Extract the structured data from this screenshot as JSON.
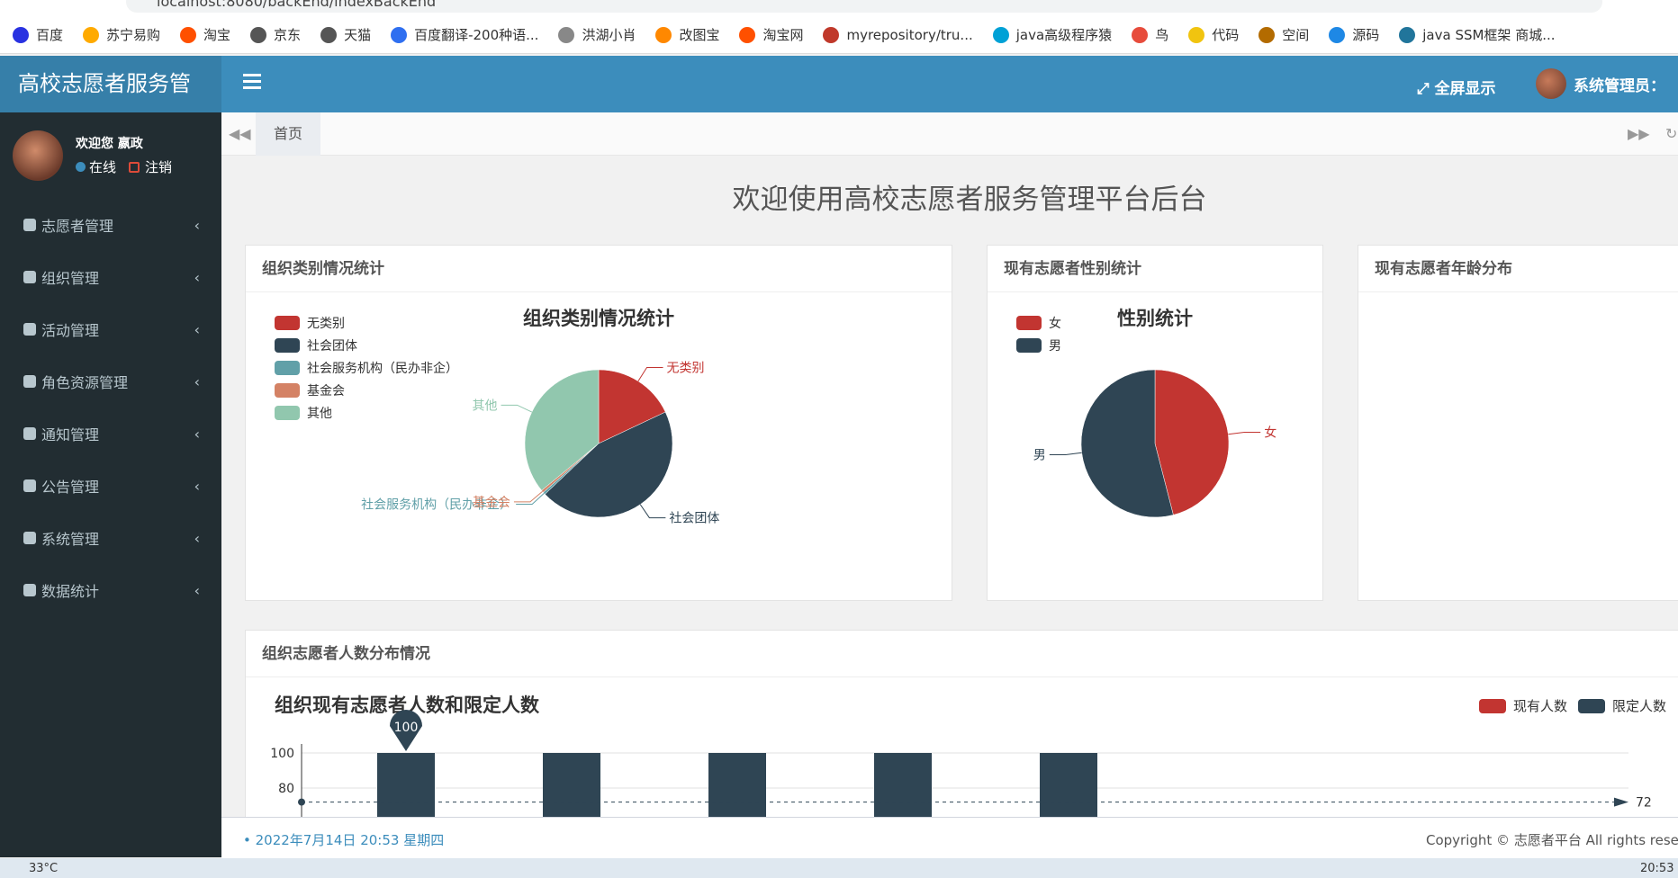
{
  "browser": {
    "url": "localhost:8080/backEnd/indexBackEnd",
    "bookmarks": [
      {
        "label": "百度",
        "color": "#2932e1"
      },
      {
        "label": "苏宁易购",
        "color": "#ffaa00"
      },
      {
        "label": "淘宝",
        "color": "#ff5000"
      },
      {
        "label": "京东",
        "color": "#555555"
      },
      {
        "label": "天猫",
        "color": "#555555"
      },
      {
        "label": "百度翻译-200种语...",
        "color": "#2f6ff0"
      },
      {
        "label": "洪湖小肖",
        "color": "#888888"
      },
      {
        "label": "改图宝",
        "color": "#ff8800"
      },
      {
        "label": "淘宝网",
        "color": "#ff5000"
      },
      {
        "label": "myrepository/tru...",
        "color": "#c0392b"
      },
      {
        "label": "java高级程序猿",
        "color": "#00a1d6"
      },
      {
        "label": "鸟",
        "color": "#e74c3c"
      },
      {
        "label": "代码",
        "color": "#f1c40f"
      },
      {
        "label": "空间",
        "color": "#b36b00"
      },
      {
        "label": "源码",
        "color": "#1e88e5"
      },
      {
        "label": "java SSM框架 商城...",
        "color": "#21759b"
      }
    ]
  },
  "header": {
    "logo": "高校志愿者服务管",
    "fullscreen_label": "全屏显示",
    "admin_label": "系统管理员：",
    "accent": "#3c8dbc"
  },
  "sidebar": {
    "welcome": "欢迎您 嬴政",
    "online": "在线",
    "logout": "注销",
    "items": [
      {
        "label": "志愿者管理"
      },
      {
        "label": "组织管理"
      },
      {
        "label": "活动管理"
      },
      {
        "label": "角色资源管理"
      },
      {
        "label": "通知管理"
      },
      {
        "label": "公告管理"
      },
      {
        "label": "系统管理"
      },
      {
        "label": "数据统计"
      }
    ]
  },
  "tabs": {
    "home": "首页"
  },
  "main": {
    "title": "欢迎使用高校志愿者服务管理平台后台",
    "box1_title": "组织类别情况统计",
    "box2_title": "现有志愿者性别统计",
    "box3_title": "现有志愿者年龄分布",
    "box4_title": "组织志愿者人数分布情况"
  },
  "chart_data": [
    {
      "type": "pie",
      "title": "组织类别情况统计",
      "series": [
        {
          "name": "无类别",
          "value": 1,
          "color": "#c23531"
        },
        {
          "name": "社会团体",
          "value": 2.5,
          "color": "#2f4554"
        },
        {
          "name": "社会服务机构（民办非企）",
          "value": 0.03,
          "color": "#61a0a8"
        },
        {
          "name": "基金会",
          "value": 0.03,
          "color": "#d48265"
        },
        {
          "name": "其他",
          "value": 2,
          "color": "#91c7ae"
        }
      ]
    },
    {
      "type": "pie",
      "title": "性别统计",
      "series": [
        {
          "name": "女",
          "value": 46,
          "color": "#c23531"
        },
        {
          "name": "男",
          "value": 54,
          "color": "#2f4554"
        }
      ]
    },
    {
      "type": "bar",
      "title": "组织现有志愿者人数和限定人数",
      "legend": [
        "现有人数",
        "限定人数"
      ],
      "colors": [
        "#c23531",
        "#2f4554"
      ],
      "y_ticks": [
        100,
        80
      ],
      "series": [
        {
          "name": "现有人数",
          "values": [
            0,
            0,
            0,
            0,
            0
          ]
        },
        {
          "name": "限定人数",
          "values": [
            100,
            100,
            100,
            100,
            100
          ]
        }
      ],
      "max_marker": "100",
      "mark_line": "72"
    }
  ],
  "footer": {
    "date": "2022年7月14日 20:53 星期四",
    "copyright": "Copyright © 志愿者平台 All rights rese"
  },
  "taskbar": {
    "weather": "33°C",
    "clock": "20:53"
  }
}
